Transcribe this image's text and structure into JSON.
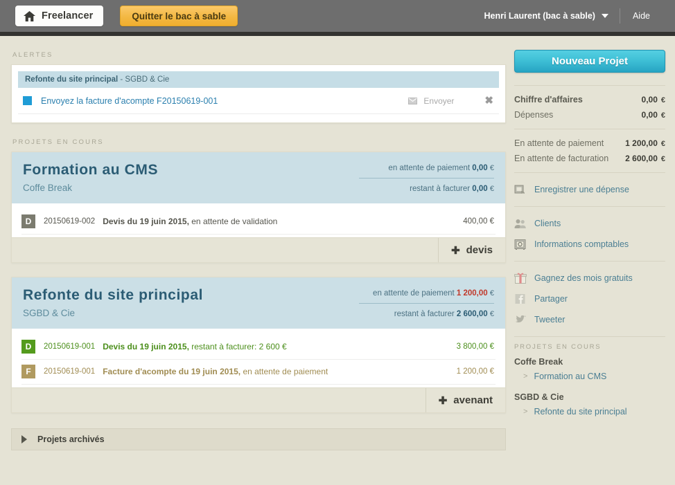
{
  "topbar": {
    "brand_label": "Freelancer",
    "brand_icon": "house-icon",
    "sandbox_button": "Quitter le bac à sable",
    "user_menu": "Henri Laurent (bac à sable)",
    "user_caret_icon": "chevron-down-icon",
    "help_link": "Aide"
  },
  "alerts": {
    "section_label": "ALERTES",
    "project_bar_title": "Refonte du site principal",
    "project_bar_client": " - SGBD & Cie",
    "items": [
      {
        "text": "Envoyez la facture d'acompte F20150619-001",
        "action_label": "Envoyer",
        "action_icon": "mail-icon",
        "close_icon": "close-icon",
        "close_glyph": "✖"
      }
    ]
  },
  "projects": {
    "section_label": "PROJETS EN COURS",
    "cards": [
      {
        "title": "Formation au CMS",
        "client": "Coffe Break",
        "pending_payment_label": "en attente de paiement",
        "pending_payment_value": "0,00",
        "pending_payment_currency": "€",
        "pending_payment_red": false,
        "remaining_label": "restant à facturer",
        "remaining_value": "0,00",
        "remaining_currency": "€",
        "documents": [
          {
            "badge": "D",
            "badge_color": "gray",
            "number": "20150619-002",
            "desc_bold": "Devis du 19 juin 2015,",
            "desc_rest": " en attente de validation",
            "amount": "400,00 €"
          }
        ],
        "add_button_label": "devis",
        "add_button_plus": "✚"
      },
      {
        "title": "Refonte du site principal",
        "client": "SGBD & Cie",
        "pending_payment_label": "en attente de paiement",
        "pending_payment_value": "1 200,00",
        "pending_payment_currency": "€",
        "pending_payment_red": true,
        "remaining_label": "restant à facturer",
        "remaining_value": "2 600,00",
        "remaining_currency": "€",
        "documents": [
          {
            "badge": "D",
            "badge_color": "green",
            "number": "20150619-001",
            "desc_bold": "Devis du 19 juin 2015,",
            "desc_rest": " restant à facturer: 2 600 €",
            "amount": "3 800,00 €"
          },
          {
            "badge": "F",
            "badge_color": "tan",
            "number": "20150619-001",
            "desc_bold": "Facture d'acompte du 19 juin 2015,",
            "desc_rest": " en attente de paiement",
            "amount": "1 200,00 €"
          }
        ],
        "add_button_label": "avenant",
        "add_button_plus": "✚"
      }
    ]
  },
  "archived": {
    "label": "Projets archivés",
    "toggle_icon": "triangle-right-icon"
  },
  "sidebar": {
    "new_project_button": "Nouveau Projet",
    "stats": [
      {
        "label": "Chiffre d'affaires",
        "value": "0,00",
        "currency": "€",
        "bold": true
      },
      {
        "label": "Dépenses",
        "value": "0,00",
        "currency": "€",
        "bold": false
      }
    ],
    "pending_stats": [
      {
        "label": "En attente de paiement",
        "value": "1 200,00",
        "currency": "€"
      },
      {
        "label": "En attente de facturation",
        "value": "2 600,00",
        "currency": "€"
      }
    ],
    "links_group_1": [
      {
        "label": "Enregistrer une dépense",
        "icon": "expense-icon"
      }
    ],
    "links_group_2": [
      {
        "label": "Clients",
        "icon": "users-icon"
      },
      {
        "label": "Informations comptables",
        "icon": "safe-icon"
      }
    ],
    "links_group_3": [
      {
        "label": "Gagnez des mois gratuits",
        "icon": "gift-icon"
      },
      {
        "label": "Partager",
        "icon": "facebook-icon"
      },
      {
        "label": "Tweeter",
        "icon": "twitter-icon"
      }
    ],
    "projects_label": "PROJETS EN COURS",
    "project_groups": [
      {
        "client": "Coffe Break",
        "projects": [
          {
            "label": "Formation au CMS",
            "chevron": ">"
          }
        ]
      },
      {
        "client": "SGBD & Cie",
        "projects": [
          {
            "label": "Refonte du site principal",
            "chevron": ">"
          }
        ]
      }
    ]
  },
  "colors": {
    "page_bg": "#e5e3d5",
    "topbar": "#6e6e6e",
    "accent_cyan": "#3fc0d6",
    "card_head": "#cbdfe6",
    "title_blue": "#2b5c74",
    "link_blue": "#4a7e93",
    "alert_blue": "#1f9cd6",
    "red": "#c0392b",
    "green_badge": "#549b1d",
    "tan_badge": "#b09a60",
    "gray_badge": "#7b7b6f",
    "sandbox_yellow": "#f3b843"
  }
}
